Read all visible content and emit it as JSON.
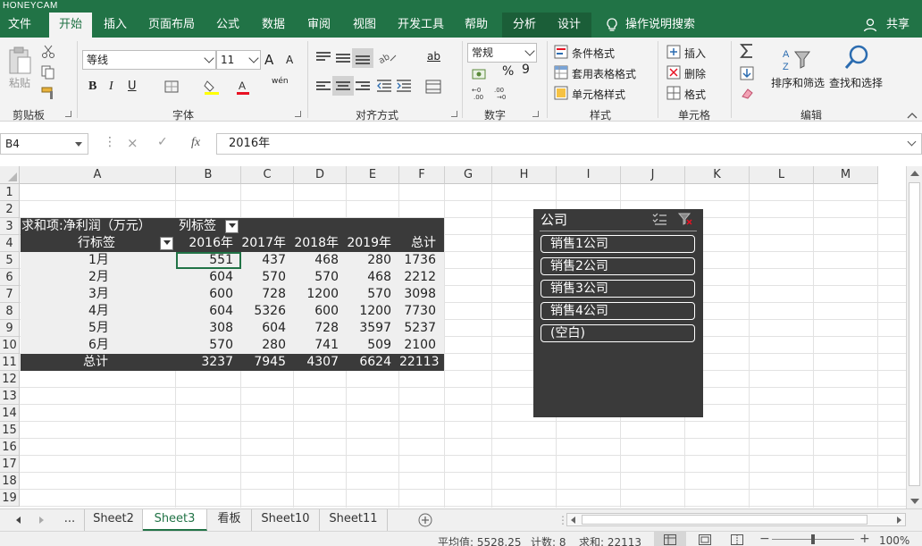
{
  "watermark": "HONEYCAM",
  "tabs": [
    "文件",
    "开始",
    "插入",
    "页面布局",
    "公式",
    "数据",
    "审阅",
    "视图",
    "开发工具",
    "帮助",
    "分析",
    "设计"
  ],
  "active_tab": "开始",
  "tell_me": "操作说明搜索",
  "share": "共享",
  "ribbon": {
    "clipboard": {
      "paste": "粘贴",
      "label": "剪贴板"
    },
    "font": {
      "name": "等线",
      "size": "11",
      "label": "字体",
      "bold": "B",
      "italic": "I",
      "underline": "U",
      "grow": "A",
      "shrink": "A",
      "phonetic": "wén"
    },
    "alignment": {
      "label": "对齐方式",
      "wrap": "ab"
    },
    "number": {
      "format": "常规",
      "percent": "%",
      "comma": "9",
      "label": "数字"
    },
    "styles": {
      "conditional": "条件格式",
      "table": "套用表格格式",
      "cell": "单元格样式",
      "label": "样式"
    },
    "cells": {
      "insert": "插入",
      "delete": "删除",
      "format": "格式",
      "label": "单元格"
    },
    "editing": {
      "sort": "排序和筛选",
      "find": "查找和选择",
      "label": "编辑"
    }
  },
  "formula_bar": {
    "name_box": "B4",
    "cancel": "×",
    "enter": "✓",
    "fx": "fx",
    "content": "2016年"
  },
  "columns": [
    "A",
    "B",
    "C",
    "D",
    "E",
    "F",
    "G",
    "H",
    "I",
    "J",
    "K",
    "L",
    "M"
  ],
  "rows": [
    "1",
    "2",
    "3",
    "4",
    "5",
    "6",
    "7",
    "8",
    "9",
    "10",
    "11",
    "12",
    "13",
    "14",
    "15",
    "16",
    "17",
    "18",
    "19"
  ],
  "pivot": {
    "value_label": "求和项:净利润（万元）",
    "col_label": "列标签",
    "row_label": "行标签",
    "years": [
      "2016年",
      "2017年",
      "2018年",
      "2019年",
      "总计"
    ],
    "data": [
      {
        "month": "1月",
        "values": [
          "551",
          "437",
          "468",
          "280",
          "1736"
        ]
      },
      {
        "month": "2月",
        "values": [
          "604",
          "570",
          "570",
          "468",
          "2212"
        ]
      },
      {
        "month": "3月",
        "values": [
          "600",
          "728",
          "1200",
          "570",
          "3098"
        ]
      },
      {
        "month": "4月",
        "values": [
          "604",
          "5326",
          "600",
          "1200",
          "7730"
        ]
      },
      {
        "month": "5月",
        "values": [
          "308",
          "604",
          "728",
          "3597",
          "5237"
        ]
      },
      {
        "month": "6月",
        "values": [
          "570",
          "280",
          "741",
          "509",
          "2100"
        ]
      }
    ],
    "total_label": "总计",
    "totals": [
      "3237",
      "7945",
      "4307",
      "6624",
      "22113"
    ]
  },
  "slicer": {
    "title": "公司",
    "items": [
      "销售1公司",
      "销售2公司",
      "销售3公司",
      "销售4公司",
      "(空白)"
    ]
  },
  "sheet_tabs": [
    "...",
    "Sheet2",
    "Sheet3",
    "看板",
    "Sheet10",
    "Sheet11"
  ],
  "active_sheet": "Sheet3",
  "status": {
    "average": "平均值: 5528.25",
    "count": "计数: 8",
    "sum": "求和: 22113",
    "zoom": "100%",
    "zoom_level": 100
  }
}
